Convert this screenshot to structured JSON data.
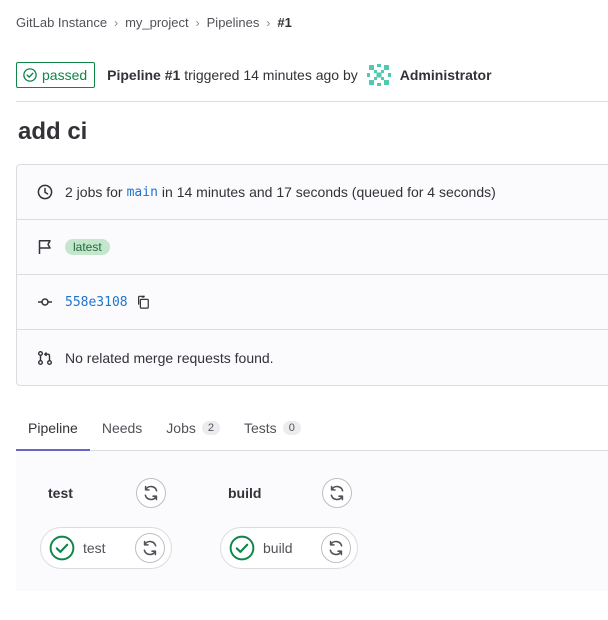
{
  "breadcrumb": {
    "items": [
      "GitLab Instance",
      "my_project",
      "Pipelines"
    ],
    "current": "#1",
    "separator": "›"
  },
  "header": {
    "status": "passed",
    "pipeline_label": "Pipeline #1",
    "triggered_text": " triggered 14 minutes ago by",
    "author": "Administrator"
  },
  "title": "add ci",
  "info": {
    "jobs_prefix": "2 jobs for",
    "ref": "main",
    "jobs_suffix": "in 14 minutes and 17 seconds (queued for 4 seconds)",
    "tag": "latest",
    "commit_sha": "558e3108",
    "merge_requests": "No related merge requests found."
  },
  "tabs": [
    {
      "label": "Pipeline"
    },
    {
      "label": "Needs"
    },
    {
      "label": "Jobs",
      "count": "2"
    },
    {
      "label": "Tests",
      "count": "0"
    }
  ],
  "graph": {
    "stages": [
      {
        "title": "test",
        "job": "test"
      },
      {
        "title": "build",
        "job": "build"
      }
    ]
  },
  "colors": {
    "success": "#108548",
    "link": "#1f75cb",
    "tab_active": "#6666c4",
    "tag_bg": "#c3e6cd"
  },
  "icons": {
    "status": "check-circle-icon",
    "clock": "clock-icon",
    "flag": "flag-icon",
    "commit": "commit-icon",
    "merge_request": "merge-request-icon",
    "copy": "copy-icon",
    "retry": "retry-icon"
  }
}
